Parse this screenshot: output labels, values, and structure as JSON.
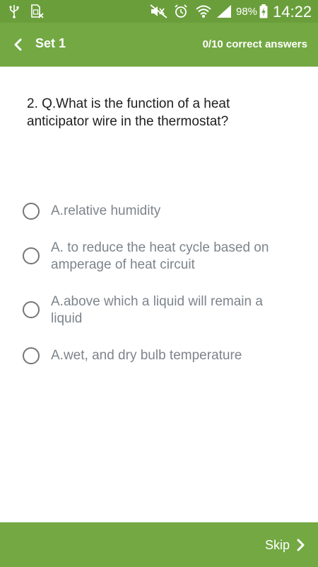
{
  "status_bar": {
    "battery_percent": "98%",
    "time": "14:22",
    "icons": [
      "usb-icon",
      "sim-card-icon",
      "mute-icon",
      "alarm-icon",
      "wifi-icon",
      "signal-icon",
      "battery-charging-icon"
    ],
    "color": "#6a9e3b"
  },
  "app_bar": {
    "title": "Set 1",
    "score": "0/10 correct answers",
    "back_icon": "chevron-left-icon",
    "color": "#73a843"
  },
  "question": {
    "text": "2. Q.What is the function of a heat anticipator wire in the thermostat?"
  },
  "options": [
    {
      "label": "A.relative humidity",
      "selected": false
    },
    {
      "label": "A. to reduce the heat cycle based on amperage of heat circuit",
      "selected": false
    },
    {
      "label": "A.above which a liquid will remain a liquid",
      "selected": false
    },
    {
      "label": "A.wet, and dry bulb temperature",
      "selected": false
    }
  ],
  "bottom_bar": {
    "skip_label": "Skip",
    "skip_icon": "chevron-right-icon"
  }
}
